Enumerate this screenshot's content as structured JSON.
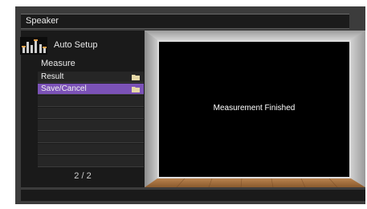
{
  "header": {
    "title": "Speaker"
  },
  "setup": {
    "label": "Auto Setup",
    "icon": "equalizer-icon"
  },
  "measure": {
    "heading": "Measure",
    "items": [
      {
        "label": "Result",
        "icon": "folder-icon",
        "selected": false
      },
      {
        "label": "Save/Cancel",
        "icon": "folder-icon",
        "selected": true
      }
    ],
    "page": "2 / 2"
  },
  "display": {
    "message": "Measurement Finished"
  },
  "colors": {
    "selected_row": "#7b52b7",
    "background": "#3c3c3c",
    "panel": "#1a1a1a"
  }
}
